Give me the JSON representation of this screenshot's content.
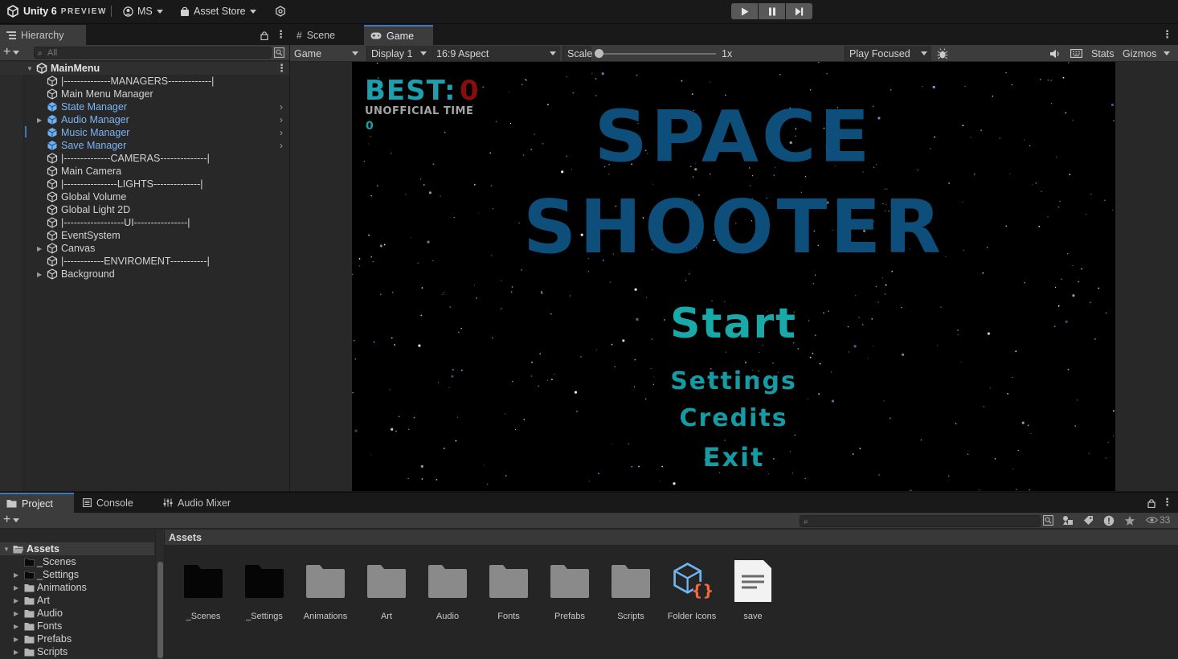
{
  "toolbar": {
    "brand": "Unity 6",
    "brand_tag": "PREVIEW",
    "account": "MS",
    "asset_store": "Asset Store"
  },
  "hierarchy": {
    "tab_label": "Hierarchy",
    "search_placeholder": "All",
    "scene_name": "MainMenu",
    "items": [
      {
        "label": "|--------------MANAGERS-------------|",
        "prefab": false,
        "foldout": false,
        "chevron": false
      },
      {
        "label": "Main Menu Manager",
        "prefab": false,
        "foldout": false,
        "chevron": false
      },
      {
        "label": "State Manager",
        "prefab": true,
        "foldout": false,
        "chevron": true
      },
      {
        "label": "Audio Manager",
        "prefab": true,
        "foldout": true,
        "chevron": true
      },
      {
        "label": "Music Manager",
        "prefab": true,
        "foldout": false,
        "chevron": true
      },
      {
        "label": "Save Manager",
        "prefab": true,
        "foldout": false,
        "chevron": true
      },
      {
        "label": "|--------------CAMERAS--------------|",
        "prefab": false,
        "foldout": false,
        "chevron": false
      },
      {
        "label": "Main Camera",
        "prefab": false,
        "foldout": false,
        "chevron": false
      },
      {
        "label": "|----------------LIGHTS--------------|",
        "prefab": false,
        "foldout": false,
        "chevron": false
      },
      {
        "label": "Global Volume",
        "prefab": false,
        "foldout": false,
        "chevron": false
      },
      {
        "label": "Global Light 2D",
        "prefab": false,
        "foldout": false,
        "chevron": false
      },
      {
        "label": "|------------------UI----------------|",
        "prefab": false,
        "foldout": false,
        "chevron": false
      },
      {
        "label": "EventSystem",
        "prefab": false,
        "foldout": false,
        "chevron": false
      },
      {
        "label": "Canvas",
        "prefab": false,
        "foldout": true,
        "chevron": false
      },
      {
        "label": "|------------ENVIROMENT-----------|",
        "prefab": false,
        "foldout": false,
        "chevron": false
      },
      {
        "label": "Background",
        "prefab": false,
        "foldout": true,
        "chevron": false
      }
    ]
  },
  "game_view": {
    "tabs": {
      "scene": "Scene",
      "game": "Game"
    },
    "mode_dropdown": "Game",
    "display_dropdown": "Display 1",
    "aspect_dropdown": "16:9 Aspect",
    "scale_label": "Scale",
    "scale_value": "1x",
    "play_mode_dropdown": "Play Focused",
    "stats_label": "Stats",
    "gizmos_label": "Gizmos",
    "game": {
      "best_label": "BEST:",
      "best_value": "0",
      "unofficial_label": "UNOFFICIAL TIME",
      "unofficial_value": "0",
      "title_line1": "SPACE",
      "title_line2": "SHOOTER",
      "menu_start": "Start",
      "menu_settings": "Settings",
      "menu_credits": "Credits",
      "menu_exit": "Exit"
    }
  },
  "project": {
    "tabs": {
      "project": "Project",
      "console": "Console",
      "audio_mixer": "Audio Mixer"
    },
    "hidden_count": "33",
    "breadcrumb": "Assets",
    "tree": {
      "root": "Assets",
      "items": [
        {
          "label": "_Scenes",
          "foldout": false,
          "dark": true
        },
        {
          "label": "_Settings",
          "foldout": true,
          "dark": true
        },
        {
          "label": "Animations",
          "foldout": true,
          "dark": false
        },
        {
          "label": "Art",
          "foldout": true,
          "dark": false
        },
        {
          "label": "Audio",
          "foldout": true,
          "dark": false
        },
        {
          "label": "Fonts",
          "foldout": true,
          "dark": false
        },
        {
          "label": "Prefabs",
          "foldout": true,
          "dark": false
        },
        {
          "label": "Scripts",
          "foldout": true,
          "dark": false
        }
      ]
    },
    "assets": [
      {
        "name": "_Scenes",
        "kind": "folder-dark"
      },
      {
        "name": "_Settings",
        "kind": "folder-dark"
      },
      {
        "name": "Animations",
        "kind": "folder"
      },
      {
        "name": "Art",
        "kind": "folder"
      },
      {
        "name": "Audio",
        "kind": "folder"
      },
      {
        "name": "Fonts",
        "kind": "folder"
      },
      {
        "name": "Prefabs",
        "kind": "folder"
      },
      {
        "name": "Scripts",
        "kind": "folder"
      },
      {
        "name": "Folder Icons",
        "kind": "package"
      },
      {
        "name": "save",
        "kind": "document"
      }
    ]
  },
  "colors": {
    "accent": "#3a79bb",
    "prefab_text": "#7cb4f5",
    "game_title": "#0d4f7a",
    "game_menu": "#149ba3",
    "best_value": "#8a0d0d"
  }
}
